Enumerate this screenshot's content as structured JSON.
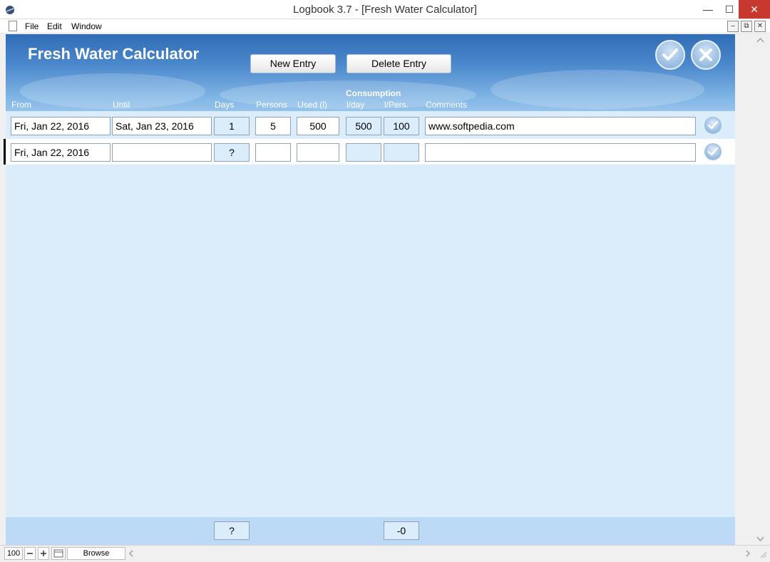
{
  "window": {
    "title": "Logbook 3.7 - [Fresh Water Calculator]",
    "minimize": "—",
    "maximize": "☐",
    "close": "✕"
  },
  "menu": {
    "items": [
      "File",
      "Edit",
      "Window"
    ]
  },
  "mdi_controls": {
    "minimize": "–",
    "restore": "⧉",
    "close": "✕"
  },
  "header": {
    "title": "Fresh Water Calculator",
    "new_entry": "New Entry",
    "delete_entry": "Delete Entry"
  },
  "columns": {
    "from": "From",
    "until": "Until",
    "days": "Days",
    "persons": "Persons",
    "used": "Used (l)",
    "consumption": "Consumption",
    "per_day": "l/day",
    "per_person": "l/Pers.",
    "comments": "Comments"
  },
  "rows": [
    {
      "from": "Fri, Jan 22, 2016",
      "until": "Sat, Jan 23, 2016",
      "days": "1",
      "persons": "5",
      "used": "500",
      "per_day": "500",
      "per_person": "100",
      "comments": "www.softpedia.com"
    },
    {
      "from": "Fri, Jan 22, 2016",
      "until": "",
      "days": "?",
      "persons": "",
      "used": "",
      "per_day": "",
      "per_person": "",
      "comments": ""
    }
  ],
  "footer": {
    "days_total": "?",
    "per_day_total": "-0"
  },
  "statusbar": {
    "zoom": "100",
    "mode": "Browse"
  },
  "colors": {
    "header_blue": "#2f6cb6",
    "panel_bg": "#dbecfb",
    "footer_bg": "#bcdaf6"
  }
}
